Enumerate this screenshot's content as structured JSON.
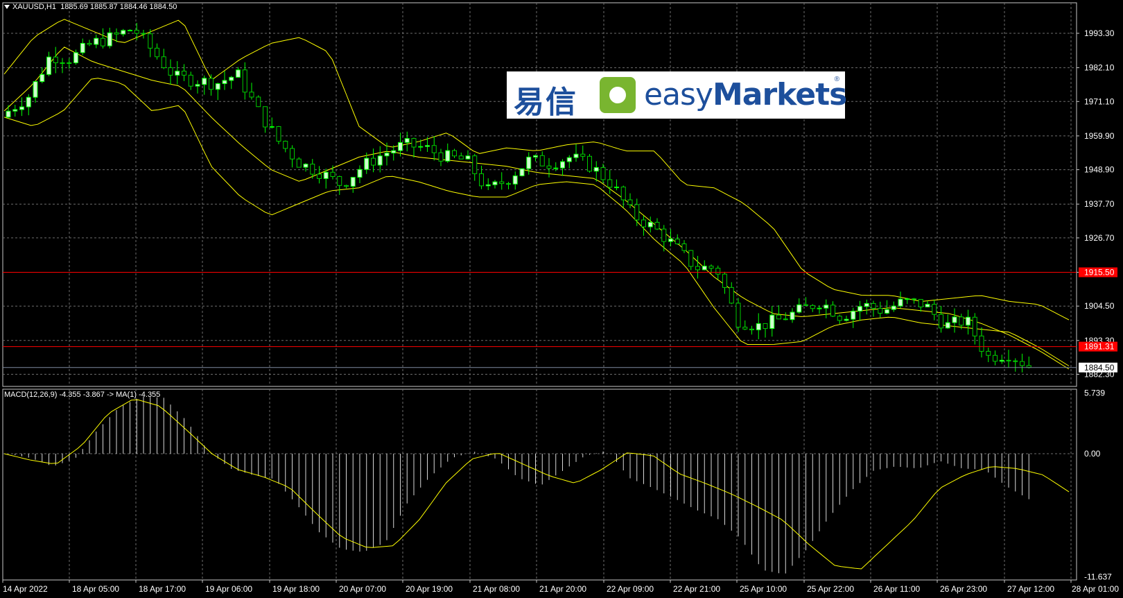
{
  "chart_data": [
    {
      "type": "candlestick",
      "symbol": "XAUUSD,H1",
      "ohlc_header": "1885.69 1885.87 1884.46 1884.50",
      "ylim": [
        1882.3,
        2001.0
      ],
      "y_ticks": [
        "1993.30",
        "1982.10",
        "1971.10",
        "1959.90",
        "1948.90",
        "1937.70",
        "1926.70",
        "1915.50",
        "1904.50",
        "1893.30",
        "1882.30"
      ],
      "x_ticks": [
        "14 Apr 2022",
        "18 Apr 05:00",
        "18 Apr 17:00",
        "19 Apr 06:00",
        "19 Apr 18:00",
        "20 Apr 07:00",
        "20 Apr 19:00",
        "21 Apr 08:00",
        "21 Apr 20:00",
        "22 Apr 09:00",
        "22 Apr 21:00",
        "25 Apr 10:00",
        "25 Apr 22:00",
        "26 Apr 11:00",
        "26 Apr 23:00",
        "27 Apr 12:00",
        "28 Apr 01:00"
      ],
      "close_anchors": [
        1968,
        1973,
        1986,
        1985,
        1990,
        1992,
        1995,
        1987,
        1979,
        1978,
        1977,
        1980,
        1968,
        1958,
        1951,
        1948,
        1944,
        1950,
        1954,
        1957,
        1956,
        1953,
        1952,
        1942,
        1946,
        1952,
        1951,
        1953,
        1950,
        1944,
        1934,
        1930,
        1924,
        1917,
        1917,
        1900,
        1898,
        1900,
        1903,
        1906,
        1901,
        1905,
        1903,
        1906,
        1905,
        1898,
        1900,
        1888,
        1889,
        1885
      ],
      "bollinger": {
        "upper": [
          1980,
          1992,
          1998,
          1994,
          1990,
          1994,
          1998,
          1978,
          1985,
          1990,
          1992,
          1987,
          1963,
          1956,
          1958,
          1961,
          1954,
          1956,
          1955,
          1957,
          1958,
          1955,
          1955,
          1944,
          1943,
          1938,
          1930,
          1916,
          1910,
          1908,
          1908,
          1906,
          1907,
          1908,
          1906,
          1905,
          1900
        ],
        "middle": [
          1968,
          1977,
          1989,
          1984,
          1981,
          1978,
          1976,
          1966,
          1957,
          1949,
          1945,
          1949,
          1953,
          1955,
          1953,
          1952,
          1951,
          1950,
          1948,
          1947,
          1946,
          1939,
          1931,
          1923,
          1914,
          1907,
          1902,
          1901,
          1902,
          1903,
          1904,
          1903,
          1902,
          1899,
          1895,
          1890,
          1884
        ],
        "lower": [
          1966,
          1963,
          1968,
          1979,
          1977,
          1968,
          1970,
          1950,
          1940,
          1934,
          1938,
          1942,
          1943,
          1947,
          1945,
          1942,
          1940,
          1940,
          1944,
          1945,
          1944,
          1936,
          1926,
          1918,
          1904,
          1892,
          1892,
          1893,
          1898,
          1900,
          1901,
          1899,
          1898,
          1897,
          1896,
          1891,
          1885
        ]
      },
      "horizontal_lines": [
        {
          "value": 1915.5,
          "label": "1915.50",
          "color": "#ff0000"
        },
        {
          "value": 1891.31,
          "label": "1891.31",
          "color": "#ff0000"
        },
        {
          "value": 1884.5,
          "label": "1884.50",
          "color": "#7e8ba0"
        }
      ],
      "colors": {
        "bull": "#ccffcc",
        "bear": "#00cc00",
        "wick": "#00ff00",
        "bollinger": "#ffff00",
        "grid": "#6e6e6e"
      }
    },
    {
      "type": "histogram",
      "label": "MACD(12,26,9) -4.355 -3.867 -> MA(1) -4.355",
      "ylim": [
        -11.637,
        5.739
      ],
      "y_ticks": [
        "5.739",
        "0.00",
        "-11.637"
      ],
      "histogram": [
        0,
        -0.4,
        -1.2,
        -0.5,
        2.2,
        4.4,
        5.4,
        5.3,
        3.2,
        0.3,
        -1.4,
        -2.0,
        -2.4,
        -4.8,
        -7.4,
        -9.0,
        -9.3,
        -8.4,
        -4.6,
        -2.2,
        -0.4,
        0.2,
        -0.5,
        -2.3,
        -3.0,
        -1.6,
        -0.2,
        0.3,
        -2.3,
        -3.2,
        -4.2,
        -5.3,
        -6.2,
        -8.0,
        -11.0,
        -11.4,
        -9.0,
        -6.0,
        -3.5,
        -1.6,
        -1.2,
        -1.4,
        -0.7,
        -1.4,
        -1.5,
        -3.1,
        -4.3
      ],
      "signal": [
        0,
        -0.6,
        -1.0,
        0.8,
        3.8,
        5.2,
        4.5,
        2.3,
        0,
        -1.5,
        -2.2,
        -3.2,
        -5.6,
        -7.9,
        -8.9,
        -8.7,
        -6.2,
        -2.8,
        -0.5,
        0.1,
        -1.0,
        -2.1,
        -2.8,
        -1.5,
        0.1,
        -0.2,
        -1.9,
        -2.8,
        -3.8,
        -5.0,
        -6.3,
        -8.6,
        -10.6,
        -10.9,
        -8.6,
        -6.3,
        -3.3,
        -2.0,
        -1.2,
        -1.4,
        -2.0,
        -3.6
      ],
      "colors": {
        "bar": "#d8d8d8",
        "signal": "#ffff00"
      }
    }
  ],
  "logo": {
    "cn": "易信",
    "en_light": "easy",
    "en_bold": "Markets",
    "reg": "®"
  }
}
